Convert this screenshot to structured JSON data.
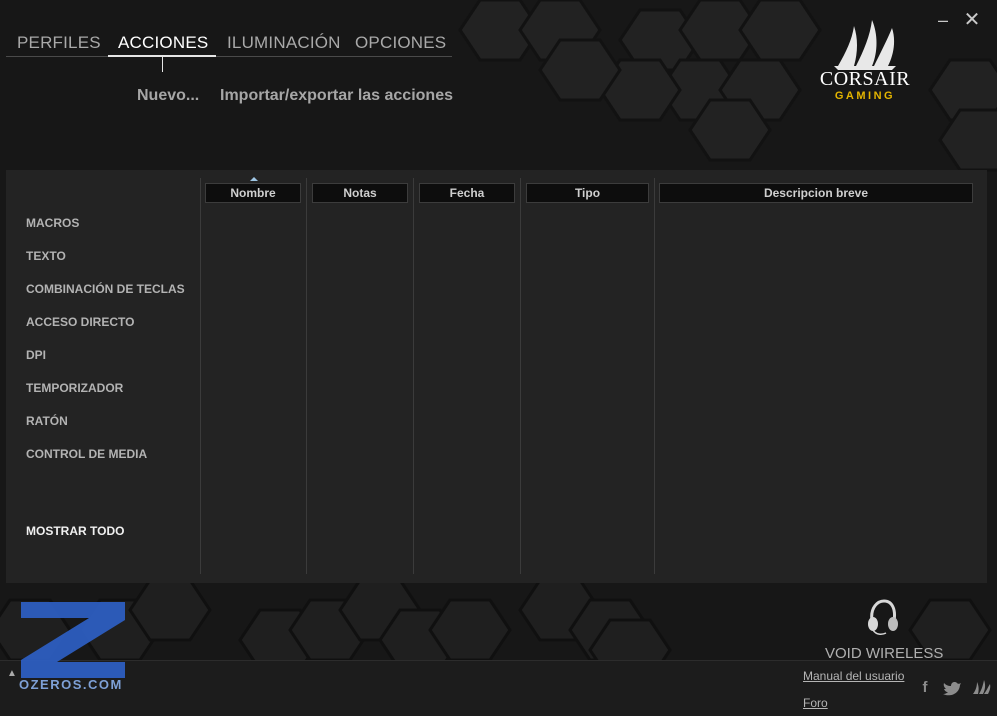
{
  "window": {
    "minimize": "–",
    "close": "✕"
  },
  "nav": {
    "tabs": [
      {
        "label": "PERFILES"
      },
      {
        "label": "ACCIONES"
      },
      {
        "label": "ILUMINACIÓN"
      },
      {
        "label": "OPCIONES"
      }
    ],
    "active_tab": "ACCIONES"
  },
  "actions": {
    "new_label": "Nuevo...",
    "import_export_label": "Importar/exportar las acciones"
  },
  "brand": {
    "name": "CORSAIR",
    "tagline": "GAMING",
    "tagline_color": "#e4b500",
    "icon": "corsair-sails-icon"
  },
  "categories": [
    "MACROS",
    "TEXTO",
    "COMBINACIÓN DE TECLAS",
    "ACCESO DIRECTO",
    "DPI",
    "TEMPORIZADOR",
    "RATÓN",
    "CONTROL DE MEDIA"
  ],
  "show_all_label": "MOSTRAR TODO",
  "table": {
    "columns": [
      "Nombre",
      "Notas",
      "Fecha",
      "Tipo",
      "Descripcion breve"
    ],
    "sorted_column": "Nombre",
    "rows": []
  },
  "device": {
    "name": "VOID WIRELESS",
    "icon": "headset-icon"
  },
  "footer": {
    "manual_link": "Manual del usuario",
    "forum_link": "Foro",
    "social_icons": [
      "facebook-icon",
      "twitter-icon",
      "corsair-icon"
    ],
    "social_glyphs": {
      "facebook": "f"
    }
  },
  "watermark": {
    "text": "OZEROS.COM",
    "color": "#2e5fc4"
  }
}
